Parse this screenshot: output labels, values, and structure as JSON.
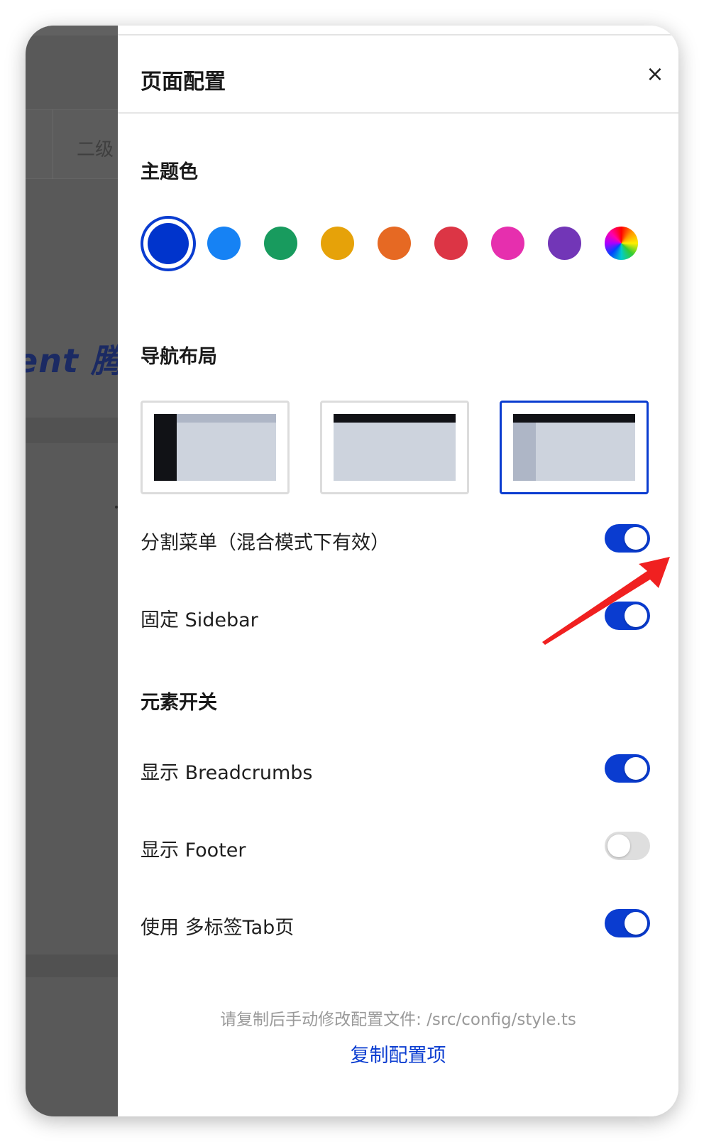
{
  "background": {
    "tab_label": "二级",
    "logo_text": "ent 腾"
  },
  "drawer": {
    "title": "页面配置",
    "close_glyph": "×"
  },
  "theme": {
    "title": "主题色",
    "swatches": [
      {
        "name": "deep-blue",
        "color": "#0034cc",
        "selected": true
      },
      {
        "name": "blue",
        "color": "#1682f4"
      },
      {
        "name": "green",
        "color": "#189b5e"
      },
      {
        "name": "yellow",
        "color": "#e6a209"
      },
      {
        "name": "orange",
        "color": "#e66923"
      },
      {
        "name": "red",
        "color": "#dc3545"
      },
      {
        "name": "pink",
        "color": "#e62fae"
      },
      {
        "name": "purple",
        "color": "#7236b7"
      },
      {
        "name": "custom",
        "color": "rainbow"
      }
    ]
  },
  "nav_layout": {
    "title": "导航布局",
    "options": [
      "side",
      "top",
      "mix"
    ],
    "selected": "mix"
  },
  "split_menu": {
    "label": "分割菜单（混合模式下有效）",
    "enabled": true
  },
  "fixed_sidebar": {
    "label": "固定 Sidebar",
    "enabled": true
  },
  "elements": {
    "title": "元素开关",
    "breadcrumbs": {
      "label": "显示 Breadcrumbs",
      "enabled": true
    },
    "footer": {
      "label": "显示 Footer",
      "enabled": false
    },
    "multi_tab": {
      "label": "使用 多标签Tab页",
      "enabled": true
    }
  },
  "footer": {
    "hint": "请复制后手动修改配置文件: /src/config/style.ts",
    "copy_label": "复制配置项"
  },
  "colors": {
    "accent": "#0a3cd0",
    "annotation_arrow": "#f02020"
  }
}
